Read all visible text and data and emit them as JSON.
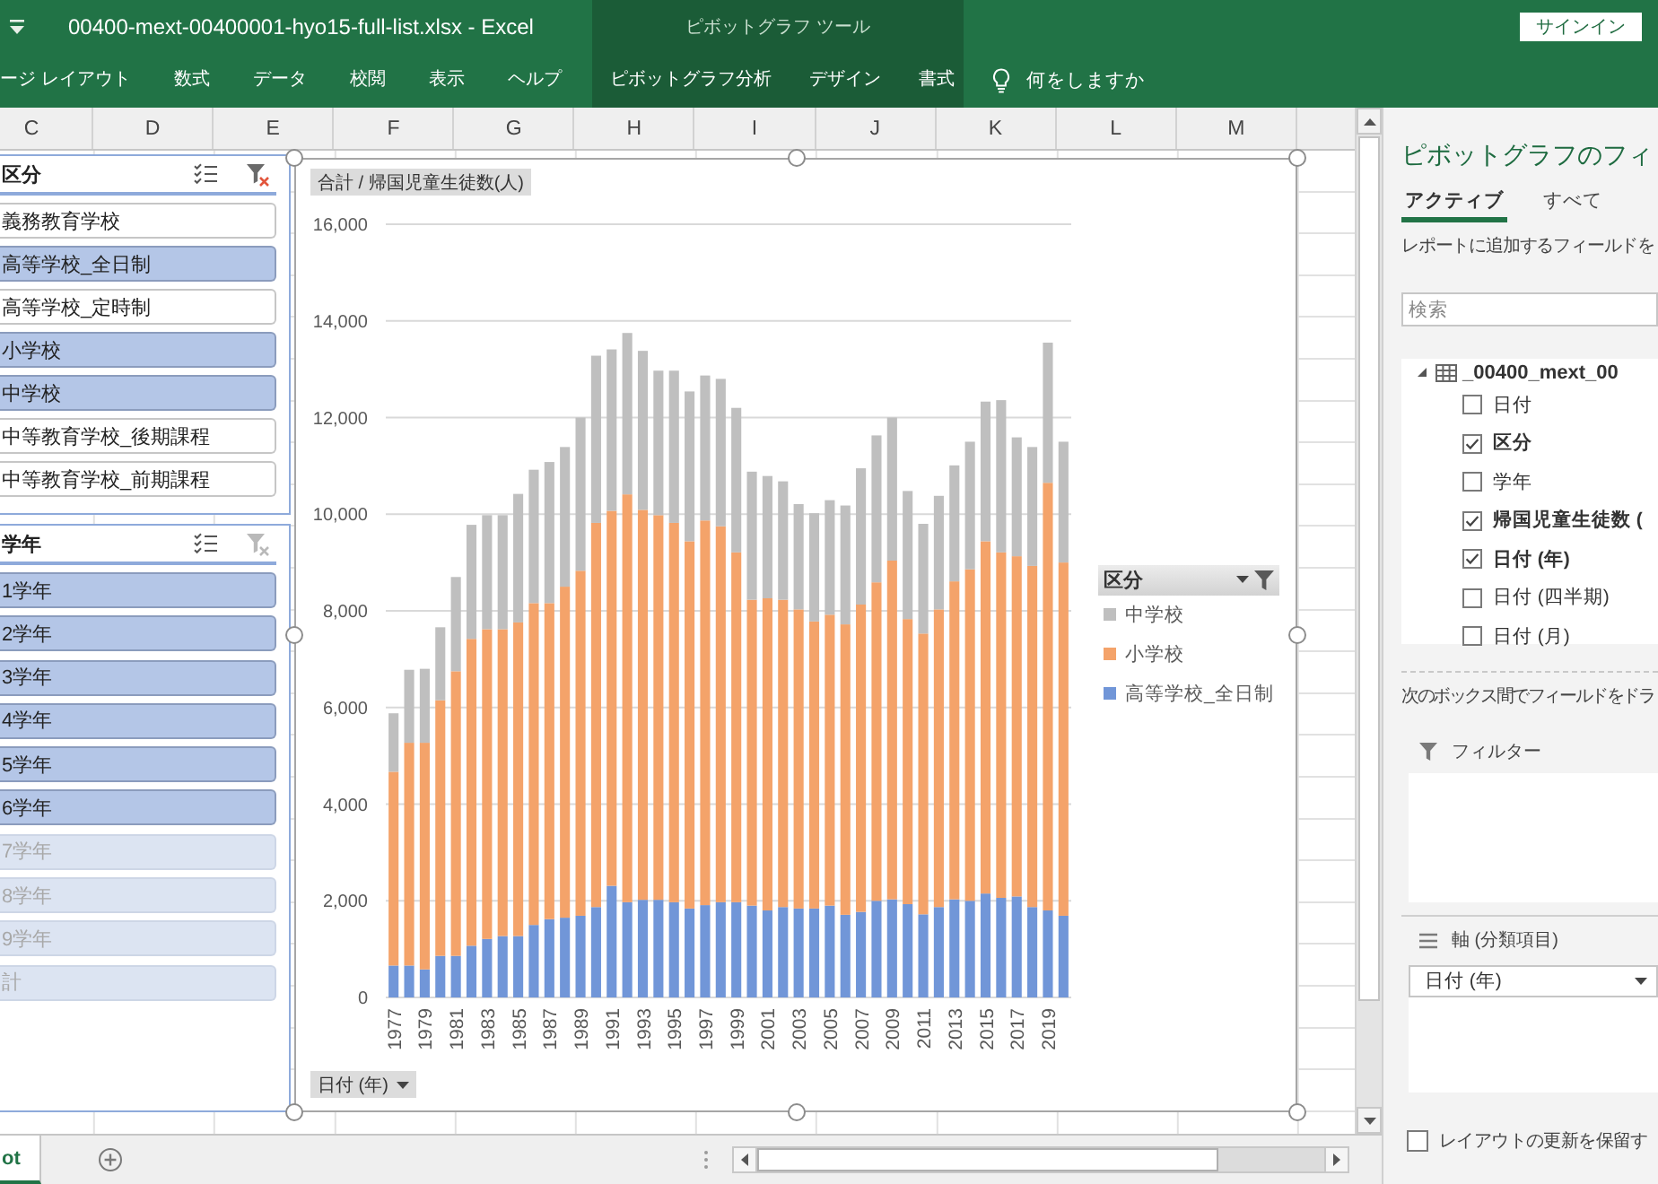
{
  "title_bar": {
    "window_title": "00400-mext-00400001-hyo15-full-list.xlsx - Excel",
    "context_title": "ピボットグラフ ツール",
    "sign_in_button": "サインイン"
  },
  "ribbon": {
    "tabs": [
      "ージ レイアウト",
      "数式",
      "データ",
      "校閲",
      "表示",
      "ヘルプ"
    ],
    "context_tabs": [
      "ピボットグラフ分析",
      "デザイン",
      "書式"
    ],
    "tell_me": "何をしますか"
  },
  "sheet": {
    "columns": [
      "C",
      "D",
      "E",
      "F",
      "G",
      "H",
      "I",
      "J",
      "K",
      "L",
      "M"
    ],
    "slicers": [
      {
        "title": "区分",
        "clear_filter_disabled": false,
        "items": [
          {
            "label": "義務教育学校",
            "selected": false,
            "disabled": false
          },
          {
            "label": "高等学校_全日制",
            "selected": true,
            "disabled": false
          },
          {
            "label": "高等学校_定時制",
            "selected": false,
            "disabled": false
          },
          {
            "label": "小学校",
            "selected": true,
            "disabled": false
          },
          {
            "label": "中学校",
            "selected": true,
            "disabled": false
          },
          {
            "label": "中等教育学校_後期課程",
            "selected": false,
            "disabled": false
          },
          {
            "label": "中等教育学校_前期課程",
            "selected": false,
            "disabled": false
          }
        ]
      },
      {
        "title": "学年",
        "clear_filter_disabled": true,
        "items": [
          {
            "label": "1学年",
            "selected": true,
            "disabled": false
          },
          {
            "label": "2学年",
            "selected": true,
            "disabled": false
          },
          {
            "label": "3学年",
            "selected": true,
            "disabled": false
          },
          {
            "label": "4学年",
            "selected": true,
            "disabled": false
          },
          {
            "label": "5学年",
            "selected": true,
            "disabled": false
          },
          {
            "label": "6学年",
            "selected": true,
            "disabled": false
          },
          {
            "label": "7学年",
            "selected": true,
            "disabled": true
          },
          {
            "label": "8学年",
            "selected": true,
            "disabled": true
          },
          {
            "label": "9学年",
            "selected": true,
            "disabled": true
          },
          {
            "label": "計",
            "selected": true,
            "disabled": true
          }
        ]
      }
    ],
    "chart": {
      "value_button": "合計 / 帰国児童生徒数(人)",
      "axis_button": {
        "label": "日付 (年)",
        "filtered": false
      },
      "legend_button": {
        "label": "区分",
        "filtered": true
      },
      "chart_data": {
        "type": "bar",
        "orientation": "vertical",
        "stacked": true,
        "grid": true,
        "legend": "right",
        "x": [
          1977,
          1978,
          1979,
          1980,
          1981,
          1982,
          1983,
          1984,
          1985,
          1986,
          1987,
          1988,
          1989,
          1990,
          1991,
          1992,
          1993,
          1994,
          1995,
          1996,
          1997,
          1998,
          1999,
          2000,
          2001,
          2002,
          2003,
          2004,
          2005,
          2006,
          2007,
          2008,
          2009,
          2010,
          2011,
          2012,
          2013,
          2014,
          2015,
          2016,
          2017,
          2018,
          2019,
          2020
        ],
        "xlim": [
          1976.5,
          2020.5
        ],
        "xticks": [
          1977,
          1979,
          1981,
          1983,
          1985,
          1987,
          1989,
          1991,
          1993,
          1995,
          1997,
          1999,
          2001,
          2003,
          2005,
          2007,
          2009,
          2011,
          2013,
          2015,
          2017,
          2019
        ],
        "ylim": [
          0,
          16000
        ],
        "yticks": [
          {
            "value": 0,
            "label": "0"
          },
          {
            "value": 2000,
            "label": "2,000"
          },
          {
            "value": 4000,
            "label": "4,000"
          },
          {
            "value": 6000,
            "label": "6,000"
          },
          {
            "value": 8000,
            "label": "8,000"
          },
          {
            "value": 10000,
            "label": "10,000"
          },
          {
            "value": 12000,
            "label": "12,000"
          },
          {
            "value": 14000,
            "label": "14,000"
          },
          {
            "value": 16000,
            "label": "16,000"
          }
        ],
        "series": [
          {
            "name": "高等学校_全日制",
            "color": "#7196d8",
            "values": [
              660,
              660,
              580,
              860,
              860,
              1070,
              1210,
              1270,
              1270,
              1500,
              1620,
              1650,
              1690,
              1870,
              2310,
              1970,
              2020,
              2020,
              1970,
              1840,
              1910,
              1970,
              1970,
              1900,
              1800,
              1870,
              1840,
              1840,
              1900,
              1710,
              1770,
              2000,
              2030,
              1930,
              1720,
              1870,
              2030,
              2000,
              2150,
              2060,
              2090,
              1870,
              1800,
              1690
            ]
          },
          {
            "name": "小学校",
            "color": "#f4a36a",
            "values": [
              4010,
              4610,
              4690,
              5290,
              5890,
              6350,
              6410,
              6350,
              6490,
              6660,
              6540,
              6850,
              7140,
              7950,
              7760,
              8440,
              8070,
              7960,
              7850,
              7600,
              7960,
              7780,
              7240,
              6330,
              6460,
              6360,
              6190,
              5940,
              6020,
              6010,
              6360,
              6590,
              7010,
              5900,
              5810,
              6160,
              6580,
              6860,
              7290,
              7150,
              7040,
              7060,
              8850,
              7310
            ]
          },
          {
            "name": "中学校",
            "color": "#bfbfbf",
            "values": [
              1210,
              1510,
              1530,
              1510,
              1950,
              2360,
              2360,
              2360,
              2660,
              2760,
              2920,
              2890,
              3170,
              3460,
              3340,
              3340,
              3290,
              2990,
              3150,
              3100,
              3000,
              3050,
              2990,
              2650,
              2530,
              2450,
              2180,
              2240,
              2370,
              2460,
              2820,
              3040,
              2960,
              2650,
              2270,
              2350,
              2400,
              2640,
              2890,
              3150,
              2460,
              2460,
              2900,
              2500
            ]
          }
        ]
      }
    }
  },
  "sheet_tabs": [
    {
      "label": "ot",
      "selected": true
    }
  ],
  "field_pane": {
    "title": "ピボットグラフのフィ",
    "tabs": [
      {
        "label": "アクティブ",
        "selected": true
      },
      {
        "label": "すべて",
        "selected": false
      }
    ],
    "hint": "レポートに追加するフィールドを",
    "search": {
      "placeholder": "検索"
    },
    "table": {
      "name": "_00400_mext_00",
      "expanded": true,
      "fields": [
        {
          "label": "日付",
          "checked": false
        },
        {
          "label": "区分",
          "checked": true
        },
        {
          "label": "学年",
          "checked": false
        },
        {
          "label": "帰国児童生徒数 (",
          "checked": true
        },
        {
          "label": "日付 (年)",
          "checked": true
        },
        {
          "label": "日付 (四半期)",
          "checked": false
        },
        {
          "label": "日付 (月)",
          "checked": false
        }
      ]
    },
    "drag_hint": "次のボックス間でフィールドをドラ",
    "areas": [
      {
        "kind": "filter",
        "label": "フィルター"
      },
      {
        "kind": "axis",
        "label": "軸 (分類項目)",
        "items": [
          "日付 (年)"
        ]
      }
    ],
    "defer_update": {
      "label": "レイアウトの更新を保留す",
      "checked": false
    }
  }
}
